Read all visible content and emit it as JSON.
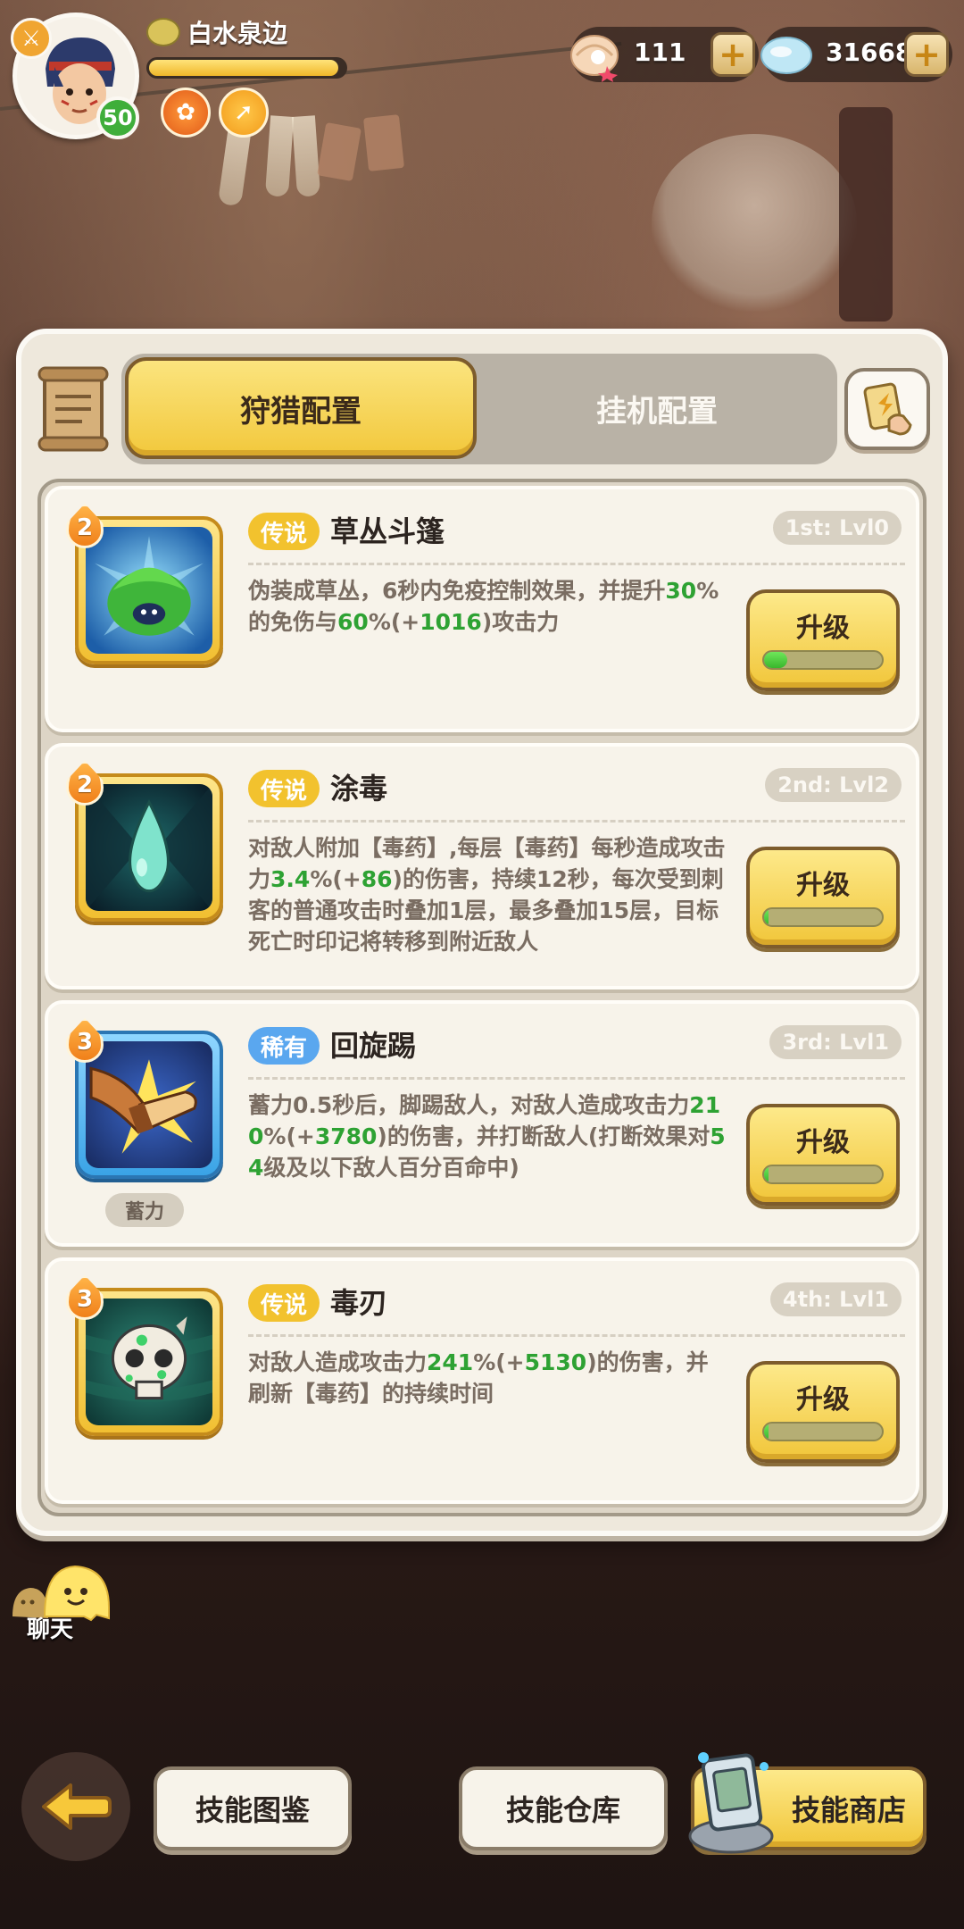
{
  "player": {
    "name": "白水泉边",
    "level": "50",
    "xp_fraction": 0.97
  },
  "resources": {
    "shell": {
      "value": "111",
      "icon": "shell-icon"
    },
    "crystal": {
      "value": "31668",
      "icon": "crystal-icon"
    }
  },
  "tabs": {
    "active": "狩猎配置",
    "inactive": "挂机配置"
  },
  "skills": [
    {
      "count": "2",
      "rarity": "传说",
      "name": "草丛斗篷",
      "slot": "1st: Lvl0",
      "desc_parts": [
        {
          "t": "伪装成草丛，6秒内免疫控制效果，并提升"
        },
        {
          "t": "30",
          "g": true
        },
        {
          "t": "%的免伤与"
        },
        {
          "t": "60",
          "g": true
        },
        {
          "t": "%(+"
        },
        {
          "t": "1016",
          "g": true
        },
        {
          "t": ")攻击力"
        }
      ],
      "upgrade_label": "升级",
      "progress": 0.2,
      "icon": "bush-cloak-icon"
    },
    {
      "count": "2",
      "rarity": "传说",
      "name": "涂毒",
      "slot": "2nd: Lvl2",
      "desc_parts": [
        {
          "t": "对敌人附加【毒药】,每层【毒药】每秒造成攻击力"
        },
        {
          "t": "3.4",
          "g": true
        },
        {
          "t": "%(+"
        },
        {
          "t": "86",
          "g": true
        },
        {
          "t": ")的伤害，持续12秒，每次受到刺客的普通攻击时叠加1层，最多叠加15层，目标死亡时印记将转移到附近敌人"
        }
      ],
      "upgrade_label": "升级",
      "progress": 0.04,
      "icon": "poison-drop-icon"
    },
    {
      "count": "3",
      "rarity": "稀有",
      "name": "回旋踢",
      "slot": "3rd: Lvl1",
      "charge_tag": "蓄力",
      "desc_parts": [
        {
          "t": "蓄力0.5秒后，脚踢敌人，对敌人造成攻击力"
        },
        {
          "t": "210",
          "g": true
        },
        {
          "t": "%(+"
        },
        {
          "t": "3780",
          "g": true
        },
        {
          "t": ")的伤害，并打断敌人(打断效果对"
        },
        {
          "t": "54",
          "g": true
        },
        {
          "t": "级及以下敌人百分百命中)"
        }
      ],
      "upgrade_label": "升级",
      "progress": 0.04,
      "icon": "spin-kick-icon"
    },
    {
      "count": "3",
      "rarity": "传说",
      "name": "毒刃",
      "slot": "4th: Lvl1",
      "desc_parts": [
        {
          "t": "对敌人造成攻击力"
        },
        {
          "t": "241",
          "g": true
        },
        {
          "t": "%(+"
        },
        {
          "t": "5130",
          "g": true
        },
        {
          "t": ")的伤害，并刷新【毒药】的持续时间"
        }
      ],
      "upgrade_label": "升级",
      "progress": 0.04,
      "icon": "poison-blade-skull-icon"
    }
  ],
  "chat": {
    "label": "聊天"
  },
  "bottom": {
    "codex": "技能图鉴",
    "storage": "技能仓库",
    "shop": "技能商店"
  }
}
